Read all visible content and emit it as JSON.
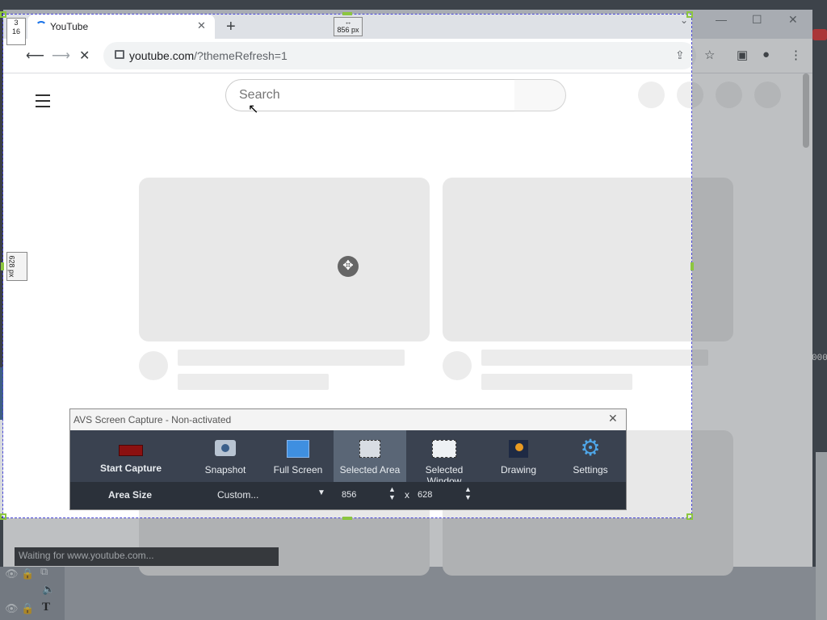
{
  "browser": {
    "tab_title": "YouTube",
    "url_host": "youtube.com",
    "url_path": "/?themeRefresh=1"
  },
  "page": {
    "search_placeholder": "Search",
    "status_text": "Waiting for www.youtube.com..."
  },
  "selection": {
    "width_label": "856 px",
    "height_label": "628 px",
    "corner_x": "3",
    "corner_y": "16"
  },
  "avs": {
    "title": "AVS Screen Capture - Non-activated",
    "tools": [
      {
        "label": "Start Capture",
        "icon": "record-icon"
      },
      {
        "label": "Snapshot",
        "icon": "camera-icon"
      },
      {
        "label": "Full Screen",
        "icon": "full-screen-icon"
      },
      {
        "label": "Selected Area",
        "icon": "selected-area-icon"
      },
      {
        "label": "Selected Window",
        "icon": "selected-window-icon"
      },
      {
        "label": "Drawing",
        "icon": "drawing-icon"
      },
      {
        "label": "Settings",
        "icon": "gear-icon"
      }
    ],
    "area_size_label": "Area Size",
    "preset": "Custom...",
    "width": "856",
    "times": "x",
    "height": "628"
  },
  "background": {
    "right_text": "000"
  },
  "colors": {
    "selection_border": "#4a48d8",
    "handle": "#8cc63f",
    "record": "#8b1010",
    "toolbar_bg": "#3a4250",
    "active_tool": "#5a6676"
  }
}
